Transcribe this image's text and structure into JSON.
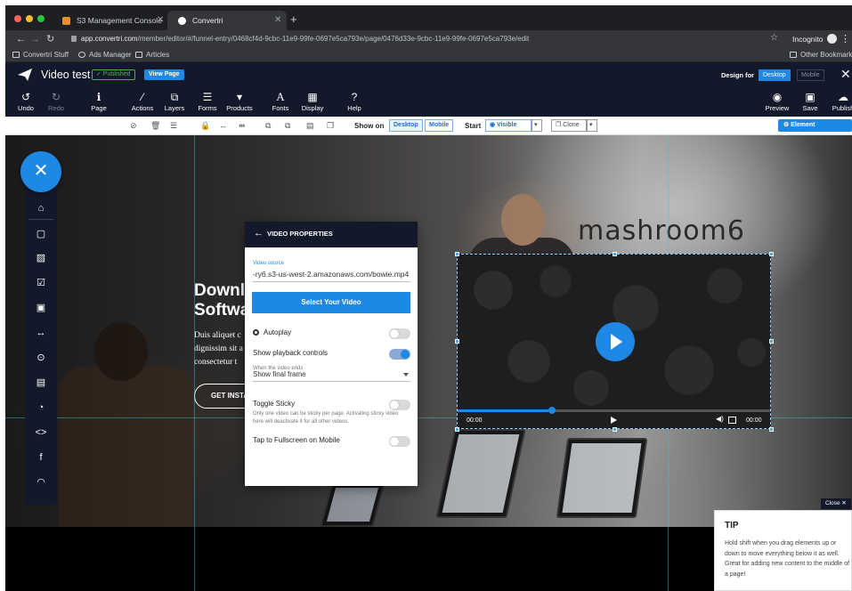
{
  "browser": {
    "tabs": [
      {
        "label": "S3 Management Console",
        "active": false
      },
      {
        "label": "Convertri",
        "active": true
      }
    ],
    "url": {
      "host": "app.convertri.com",
      "path": "/member/editor/#/funnel-entry/0468cf4d-9cbc-11e9-99fe-0697e5ca793e/page/0476d33e-9cbc-11e9-99fe-0697e5ca793e/edit"
    },
    "incognito_label": "Incognito",
    "bookmarks": [
      "Convertri Stuff",
      "Ads Manager",
      "Articles"
    ],
    "other_bookmarks": "Other Bookmarks"
  },
  "appbar": {
    "title": "Video test",
    "published_badge": "✓ Published",
    "view_page": "View Page",
    "design_for_label": "Design for",
    "design_options": [
      "Desktop",
      "Mobile"
    ]
  },
  "toolbar": {
    "left": [
      {
        "label": "Undo",
        "icon": "undo-icon"
      },
      {
        "label": "Redo",
        "icon": "redo-icon"
      },
      {
        "label": "Page",
        "icon": "info-icon"
      },
      {
        "label": "Actions",
        "icon": "wand-icon"
      },
      {
        "label": "Layers",
        "icon": "layers-icon"
      },
      {
        "label": "Forms",
        "icon": "forms-icon"
      },
      {
        "label": "Products",
        "icon": "cart-icon"
      },
      {
        "label": "Fonts",
        "icon": "font-icon"
      },
      {
        "label": "Display",
        "icon": "grid-icon"
      },
      {
        "label": "Help",
        "icon": "help-icon"
      }
    ],
    "right": [
      {
        "label": "Preview",
        "icon": "eye-icon"
      },
      {
        "label": "Save",
        "icon": "save-icon"
      },
      {
        "label": "Publish",
        "icon": "cloud-upload-icon"
      }
    ]
  },
  "propbar": {
    "show_on_label": "Show on",
    "show_on_options": [
      "Desktop",
      "Mobile"
    ],
    "start_label": "Start",
    "start_value": "◉ Visible",
    "clone_label": "Clone",
    "element_properties": "⚙ Element Properties"
  },
  "hero": {
    "title_line1": "Downl",
    "title_line2": "Softwa",
    "body_line1": "Duis aliquet c",
    "body_line2": "dignissim sit a",
    "body_line3": "consectetur t",
    "button": "GET INSTA",
    "wall_sign": "mashroom6"
  },
  "video": {
    "time_current": "00:00",
    "time_total": "00:00",
    "progress": 0.3
  },
  "video_properties": {
    "title": "VIDEO PROPERTIES",
    "source_label": "Video source",
    "source_value": "-ry6.s3-us-west-2.amazonaws.com/bowie.mp4",
    "select_button": "Select Your Video",
    "autoplay_label": "Autoplay",
    "autoplay_on": false,
    "controls_label": "Show playback controls",
    "controls_on": true,
    "ends_label": "When the video ends",
    "ends_value": "Show final frame",
    "sticky_label": "Toggle Sticky",
    "sticky_help": "Only one video can be sticky per page. Activating sticky video here will deactivate it for all other videos.",
    "sticky_on": false,
    "fullscreen_label": "Tap to Fullscreen on Mobile",
    "fullscreen_on": false
  },
  "tip": {
    "close": "Close ✕",
    "title": "TIP",
    "body": "Hold shift when you drag elements up or down to move everything below it as well. Great for adding new content to the middle of a page!"
  },
  "colors": {
    "accent": "#1e88e5",
    "navy": "#14182b",
    "published": "#4caf50"
  }
}
